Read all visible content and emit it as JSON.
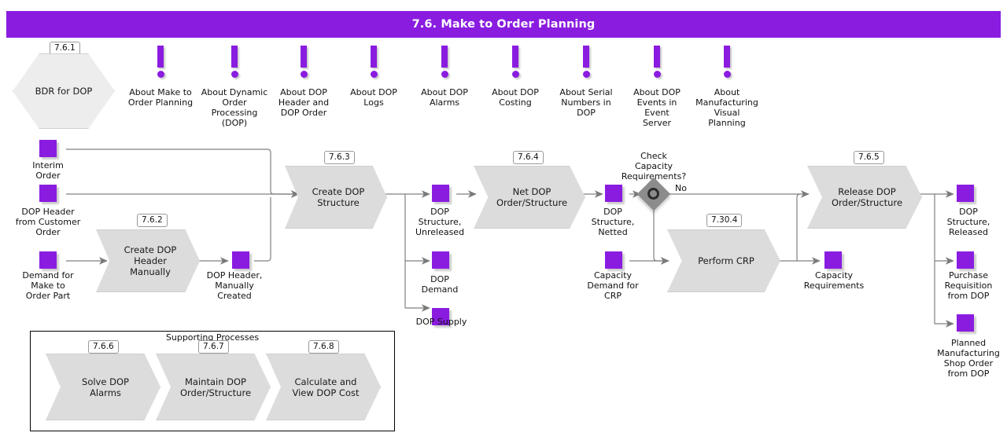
{
  "header": {
    "title": "7.6. Make to Order Planning",
    "bg": "#8A1CE0",
    "fg": "#ffffff"
  },
  "colors": {
    "accent": "#8A1CE0",
    "process_fill": "#DCDCDC",
    "hex_fill": "#EDEDED",
    "diamond_fill": "#8C8C8C",
    "wire": "#808080"
  },
  "bdr": {
    "tag": "7.6.1",
    "label": "BDR for DOP"
  },
  "info_items": [
    {
      "label": "About Make to\nOrder Planning",
      "icon": "exclamation-icon"
    },
    {
      "label": "About Dynamic\nOrder\nProcessing\n(DOP)",
      "icon": "exclamation-icon"
    },
    {
      "label": "About DOP\nHeader and\nDOP Order",
      "icon": "exclamation-icon"
    },
    {
      "label": "About DOP\nLogs",
      "icon": "exclamation-icon"
    },
    {
      "label": "About DOP\nAlarms",
      "icon": "exclamation-icon"
    },
    {
      "label": "About DOP\nCosting",
      "icon": "exclamation-icon"
    },
    {
      "label": "About Serial\nNumbers in\nDOP",
      "icon": "exclamation-icon"
    },
    {
      "label": "About DOP\nEvents in\nEvent\nServer",
      "icon": "exclamation-icon"
    },
    {
      "label": "About\nManufacturing\nVisual\nPlanning",
      "icon": "exclamation-icon"
    }
  ],
  "processes": [
    {
      "id": "create-dop-header-manually",
      "tag": "7.6.2",
      "label": "Create DOP\nHeader\nManually"
    },
    {
      "id": "create-dop-structure",
      "tag": "7.6.3",
      "label": "Create DOP\nStructure"
    },
    {
      "id": "net-dop-order-structure",
      "tag": "7.6.4",
      "label": "Net DOP\nOrder/Structure"
    },
    {
      "id": "perform-crp",
      "tag": "7.30.4",
      "label": "Perform CRP"
    },
    {
      "id": "release-dop-order-structure",
      "tag": "7.6.5",
      "label": "Release DOP\nOrder/Structure"
    }
  ],
  "data_objects": [
    {
      "id": "interim-order",
      "label": "Interim\nOrder"
    },
    {
      "id": "dop-header-from-customer-order",
      "label": "DOP Header\nfrom Customer\nOrder"
    },
    {
      "id": "demand-for-make-to-order-part",
      "label": "Demand for\nMake to\nOrder Part"
    },
    {
      "id": "dop-header-manually-created",
      "label": "DOP Header,\nManually\nCreated"
    },
    {
      "id": "dop-structure-unreleased",
      "label": "DOP\nStructure,\nUnreleased"
    },
    {
      "id": "dop-demand",
      "label": "DOP\nDemand"
    },
    {
      "id": "dop-supply",
      "label": "DOP Supply"
    },
    {
      "id": "dop-structure-netted",
      "label": "DOP\nStructure,\nNetted"
    },
    {
      "id": "capacity-demand-for-crp",
      "label": "Capacity\nDemand for\nCRP"
    },
    {
      "id": "capacity-requirements",
      "label": "Capacity\nRequirements"
    },
    {
      "id": "dop-structure-released",
      "label": "DOP\nStructure,\nReleased"
    },
    {
      "id": "purchase-requisition-from-dop",
      "label": "Purchase\nRequisition\nfrom DOP"
    },
    {
      "id": "planned-manufacturing-shop-order-from-dop",
      "label": "Planned\nManufacturing\nShop Order\nfrom DOP"
    }
  ],
  "decision": {
    "id": "check-capacity-requirements",
    "label": "Check\nCapacity\nRequirements?",
    "branch_label": "No"
  },
  "supporting": {
    "title": "Supporting Processes",
    "items": [
      {
        "tag": "7.6.6",
        "label": "Solve DOP\nAlarms"
      },
      {
        "tag": "7.6.7",
        "label": "Maintain DOP\nOrder/Structure"
      },
      {
        "tag": "7.6.8",
        "label": "Calculate and\nView DOP Cost"
      }
    ]
  }
}
